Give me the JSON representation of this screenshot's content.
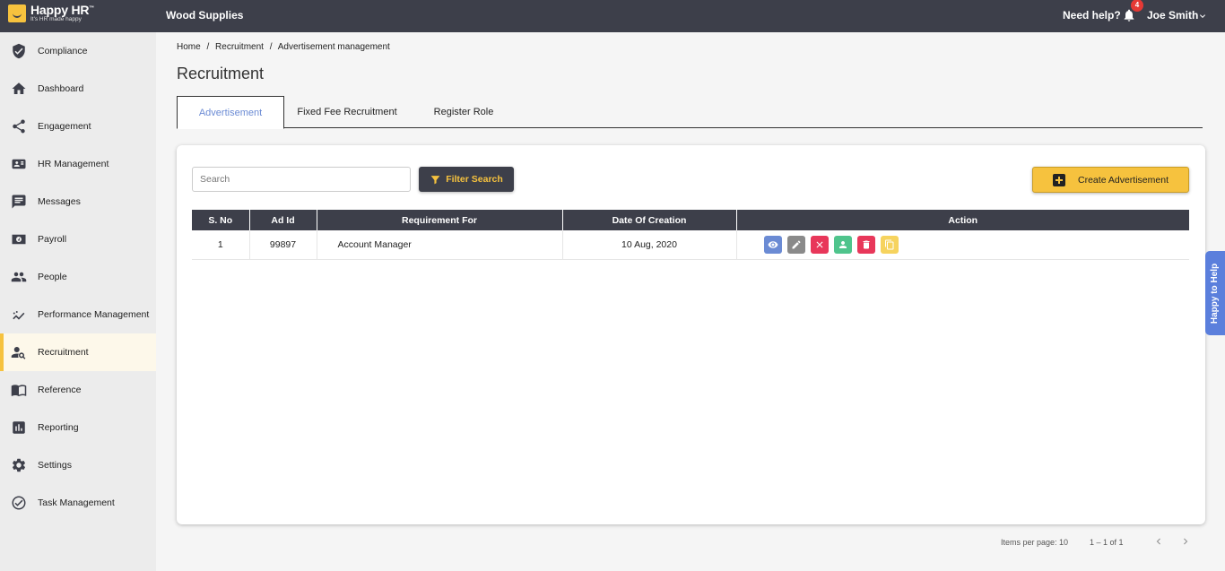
{
  "app": {
    "logo_title": "Happy HR",
    "logo_tm": "™",
    "logo_tagline": "It's HR made happy",
    "company": "Wood Supplies",
    "need_help": "Need help?",
    "notifications": "4",
    "user": "Joe Smith"
  },
  "sidebar": {
    "items": [
      {
        "label": "Compliance",
        "icon": "shield-check-icon"
      },
      {
        "label": "Dashboard",
        "icon": "home-icon"
      },
      {
        "label": "Engagement",
        "icon": "share-icon"
      },
      {
        "label": "HR Management",
        "icon": "id-card-icon"
      },
      {
        "label": "Messages",
        "icon": "message-icon"
      },
      {
        "label": "Payroll",
        "icon": "money-icon"
      },
      {
        "label": "People",
        "icon": "people-icon"
      },
      {
        "label": "Performance Management",
        "icon": "trend-icon"
      },
      {
        "label": "Recruitment",
        "icon": "person-search-icon"
      },
      {
        "label": "Reference",
        "icon": "book-icon"
      },
      {
        "label": "Reporting",
        "icon": "chart-icon"
      },
      {
        "label": "Settings",
        "icon": "gear-icon"
      },
      {
        "label": "Task Management",
        "icon": "check-circle-icon"
      }
    ],
    "active": "Recruitment"
  },
  "breadcrumb": [
    "Home",
    "/",
    "Recruitment",
    "/",
    "Advertisement management"
  ],
  "page_title": "Recruitment",
  "tabs": [
    "Advertisement",
    "Fixed Fee Recruitment",
    "Register Role"
  ],
  "search_placeholder": "Search",
  "filter_label": "Filter Search",
  "create_label": "Create Advertisement",
  "table": {
    "headers": [
      "S. No",
      "Ad Id",
      "Requirement For",
      "Date Of Creation",
      "Action"
    ],
    "rows": [
      {
        "sno": "1",
        "ad_id": "99897",
        "requirement": "Account Manager",
        "date": "10 Aug, 2020"
      }
    ]
  },
  "actions": [
    {
      "name": "view-icon",
      "color": "#6b8bd4"
    },
    {
      "name": "edit-icon",
      "color": "#8a8a8a"
    },
    {
      "name": "close-icon",
      "color": "#e8375a"
    },
    {
      "name": "person-icon",
      "color": "#4fc48c"
    },
    {
      "name": "delete-icon",
      "color": "#e8375a"
    },
    {
      "name": "copy-icon",
      "color": "#f6d35e"
    }
  ],
  "pagination": {
    "items_per_page": "Items per page: 10",
    "range": "1 – 1 of 1"
  },
  "help_tab": "Happy to Help",
  "colors": {
    "topbar": "#3d3f4a",
    "accent": "#f6c23e",
    "tab_active": "#6b8bd4"
  }
}
